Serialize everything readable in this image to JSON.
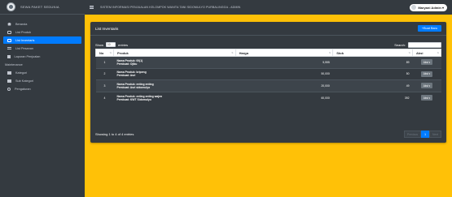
{
  "sidebar": {
    "brand": "SEWA PAKET SEDUNIA",
    "items": [
      {
        "label": "Beranda",
        "icon": "home-icon"
      },
      {
        "label": "List Produk",
        "icon": "box-icon"
      },
      {
        "label": "List Inventaris",
        "icon": "box-icon",
        "active": true
      },
      {
        "label": "List Pesanan",
        "icon": "list-icon"
      },
      {
        "label": "Laporan Penjualan",
        "icon": "file-icon"
      }
    ],
    "section_header": "Maintenance",
    "maintenance_items": [
      {
        "label": "Kategori",
        "icon": "table-icon"
      },
      {
        "label": "Sub Kategori",
        "icon": "table-icon"
      },
      {
        "label": "Pengaturan",
        "icon": "cog-icon"
      }
    ]
  },
  "topbar": {
    "title": "SISTEM INFORMASI PENJUALAN KELOMPOK WANITA TANI SIDOMULYO PURBALINGGA - ADMIN",
    "user": "Maryani Admin ▾"
  },
  "card": {
    "title": "List Inventaris",
    "add_button": "+Buat Baru",
    "show_label": "Show",
    "entries_value": "10",
    "entries_label": "entries",
    "search_label": "Search:",
    "columns": [
      "No",
      "Produk",
      "Harga",
      "Stok",
      "Aksi"
    ],
    "rows": [
      {
        "no": "1",
        "nama": "Nama Produk: 00(1)",
        "pembuat": "Pembuat: Ojiku",
        "harga": "5,555",
        "stok": "89",
        "aksi": "Aksi ▾"
      },
      {
        "no": "2",
        "nama": "Nama Produk: kripeng",
        "pembuat": "Pembuat: Asri",
        "harga": "50,000",
        "stok": "50",
        "aksi": "Aksi ▾"
      },
      {
        "no": "3",
        "nama": "Nama Produk: enting enting",
        "pembuat": "Pembuat: Asri sidomulyo",
        "harga": "20,000",
        "stok": "49",
        "aksi": "Aksi ▾"
      },
      {
        "no": "4",
        "nama": "Nama Produk: enting enting wajen",
        "pembuat": "Pembuat: KWT Sidomulyo",
        "harga": "60,000",
        "stok": "392",
        "aksi": "Aksi ▾"
      }
    ],
    "info": "Showing 1 to 4 of 4 entries",
    "pagination": {
      "previous": "Previous",
      "page": "1",
      "next": "Next"
    }
  },
  "colors": {
    "accent": "#007bff",
    "background": "#ffc107",
    "dark": "#343a40"
  }
}
